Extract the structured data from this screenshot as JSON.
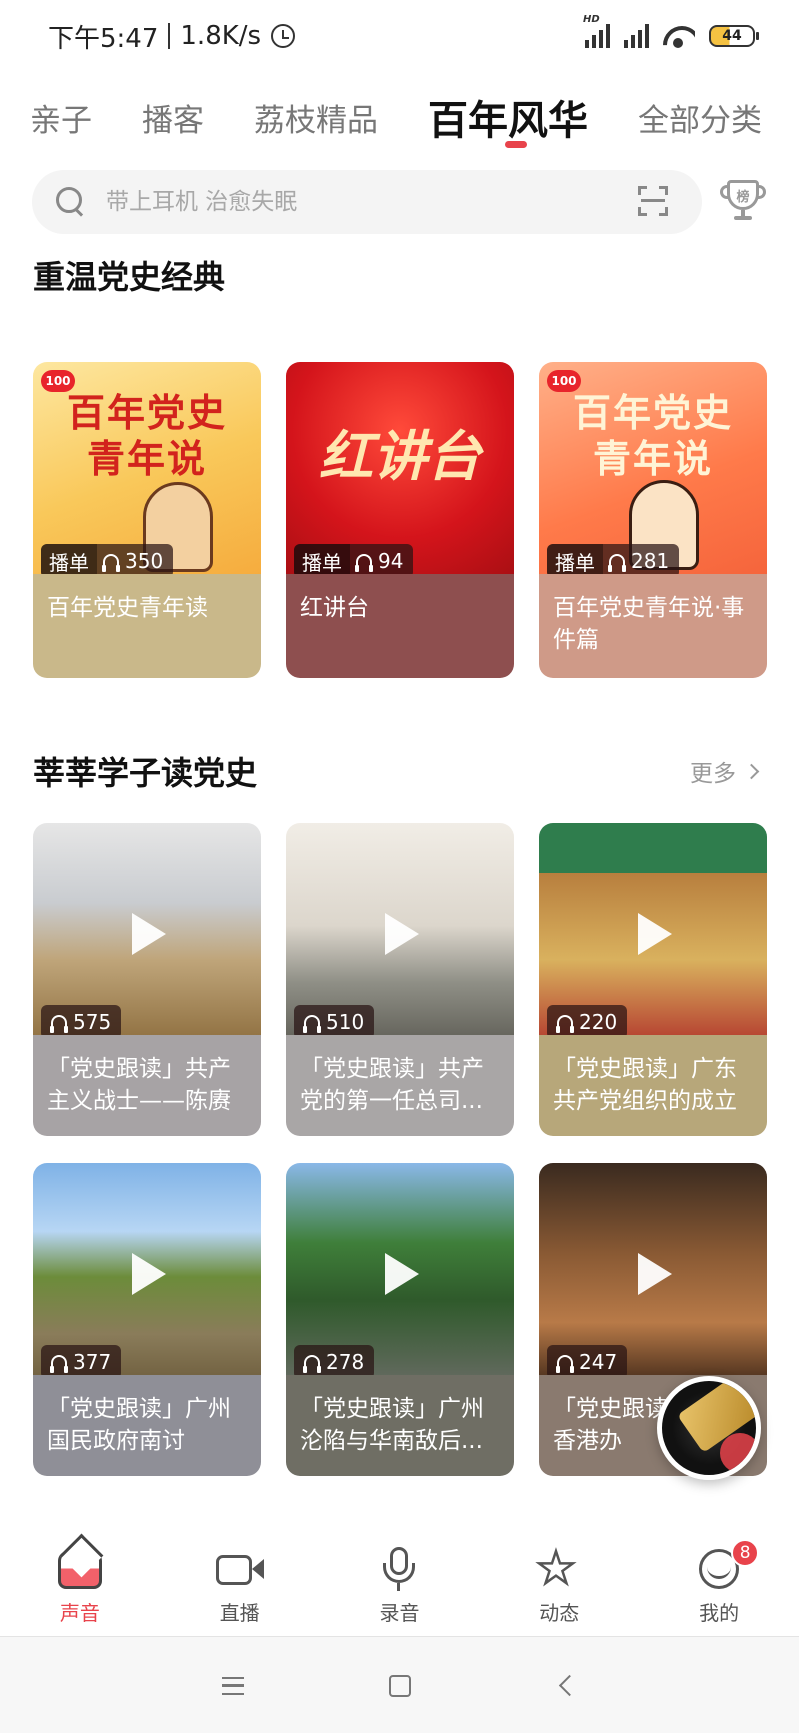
{
  "status_bar": {
    "time": "下午5:47",
    "net_speed": "1.8K/s",
    "battery": "44",
    "signal_label": "HD"
  },
  "tabs": [
    "亲子",
    "播客",
    "荔枝精品",
    "百年风华",
    "全部分类"
  ],
  "active_tab_index": 3,
  "search": {
    "placeholder": "带上耳机 治愈失眠",
    "rank_label": "榜"
  },
  "section1": {
    "title": "重温党史经典",
    "cards": [
      {
        "tag": "播单",
        "listens": "350",
        "caption": "百年党史青年读",
        "cover_text": "百年党史\n青年说",
        "caption_color": "#c9b88a"
      },
      {
        "tag": "播单",
        "listens": "94",
        "caption": "红讲台",
        "cover_text": "红讲台",
        "caption_color": "#8e4f4f"
      },
      {
        "tag": "播单",
        "listens": "281",
        "caption": "百年党史青年说·事件篇",
        "cover_text": "百年党史\n青年说",
        "caption_color": "#cf9a88"
      }
    ]
  },
  "section2": {
    "title": "莘莘学子读党史",
    "more": "更多",
    "cards": [
      {
        "listens": "575",
        "caption": "「党史跟读」共产主义战士——陈赓",
        "caption_color": "#a7a3a5"
      },
      {
        "listens": "510",
        "caption": "「党史跟读」共产党的第一任总司...",
        "caption_color": "#a9a6a6"
      },
      {
        "listens": "220",
        "caption": "「党史跟读」广东共产党组织的成立",
        "caption_color": "#b7a77a"
      },
      {
        "listens": "377",
        "caption": "「党史跟读」广州国民政府南讨",
        "caption_color": "#8f8f97"
      },
      {
        "listens": "278",
        "caption": "「党史跟读」广州沦陷与华南敌后...",
        "caption_color": "#6f6e64"
      },
      {
        "listens": "247",
        "caption": "「党史跟读」军驻香港办",
        "caption_color": "#8a7a6f"
      }
    ]
  },
  "bottom_nav": [
    {
      "label": "声音",
      "icon": "home-icon",
      "active": true
    },
    {
      "label": "直播",
      "icon": "video-camera-icon",
      "active": false
    },
    {
      "label": "录音",
      "icon": "microphone-icon",
      "active": false
    },
    {
      "label": "动态",
      "icon": "star-icon",
      "active": false
    },
    {
      "label": "我的",
      "icon": "profile-icon",
      "active": false,
      "badge": "8"
    }
  ],
  "colors": {
    "accent": "#e8434b",
    "active_tab": "#111111",
    "inactive_tab": "#777777"
  }
}
